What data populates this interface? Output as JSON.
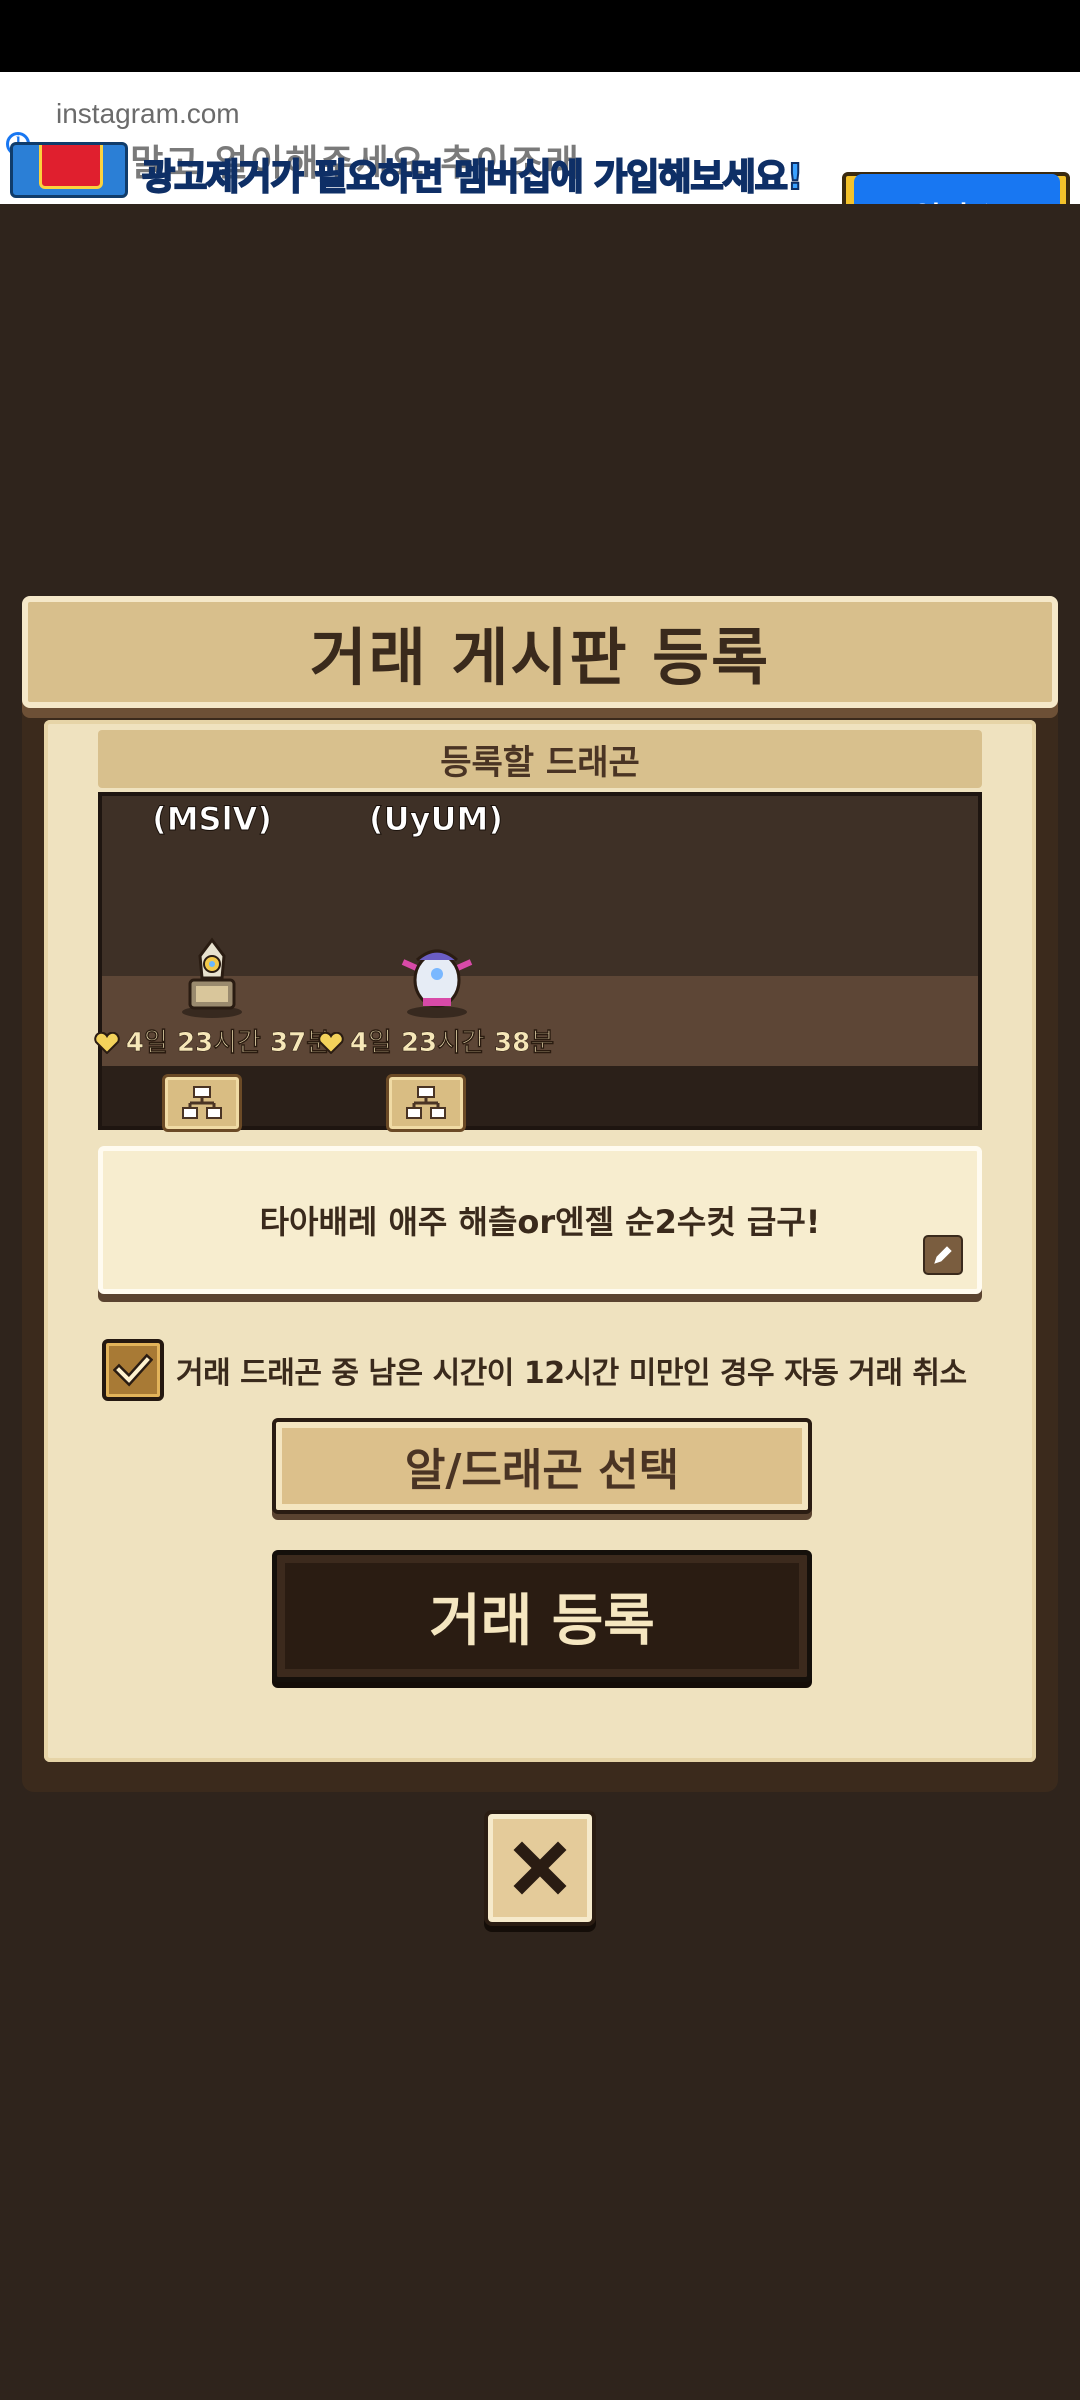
{
  "ad": {
    "domain": "instagram.com",
    "underlay_text": "배경말고 얼이해주세요 추이조래",
    "banner_text": "광고제거가 필요하면 멤버십에 가입해보세요!",
    "open_button_label": "열기"
  },
  "modal": {
    "title": "거래 게시판 등록",
    "section_label": "등록할 드래곤",
    "dragons": [
      {
        "name": "(MSlV)",
        "timer": "4일 23시간 37분"
      },
      {
        "name": "(UyUM)",
        "timer": "4일 23시간 38분"
      }
    ],
    "message": "타아배레 애주 해츨or엔젤 순2수컷 급구!",
    "auto_cancel": {
      "checked": true,
      "label": "거래 드래곤 중 남은 시간이 12시간 미만인 경우 자동 거래 취소"
    },
    "select_button_label": "알/드래곤 선택",
    "register_button_label": "거래 등록"
  },
  "colors": {
    "background": "#2f241c",
    "paper": "#efe2bf",
    "header": "#d8bf8c",
    "dark_button": "#2a1c12",
    "ad_blue": "#1877f2"
  }
}
